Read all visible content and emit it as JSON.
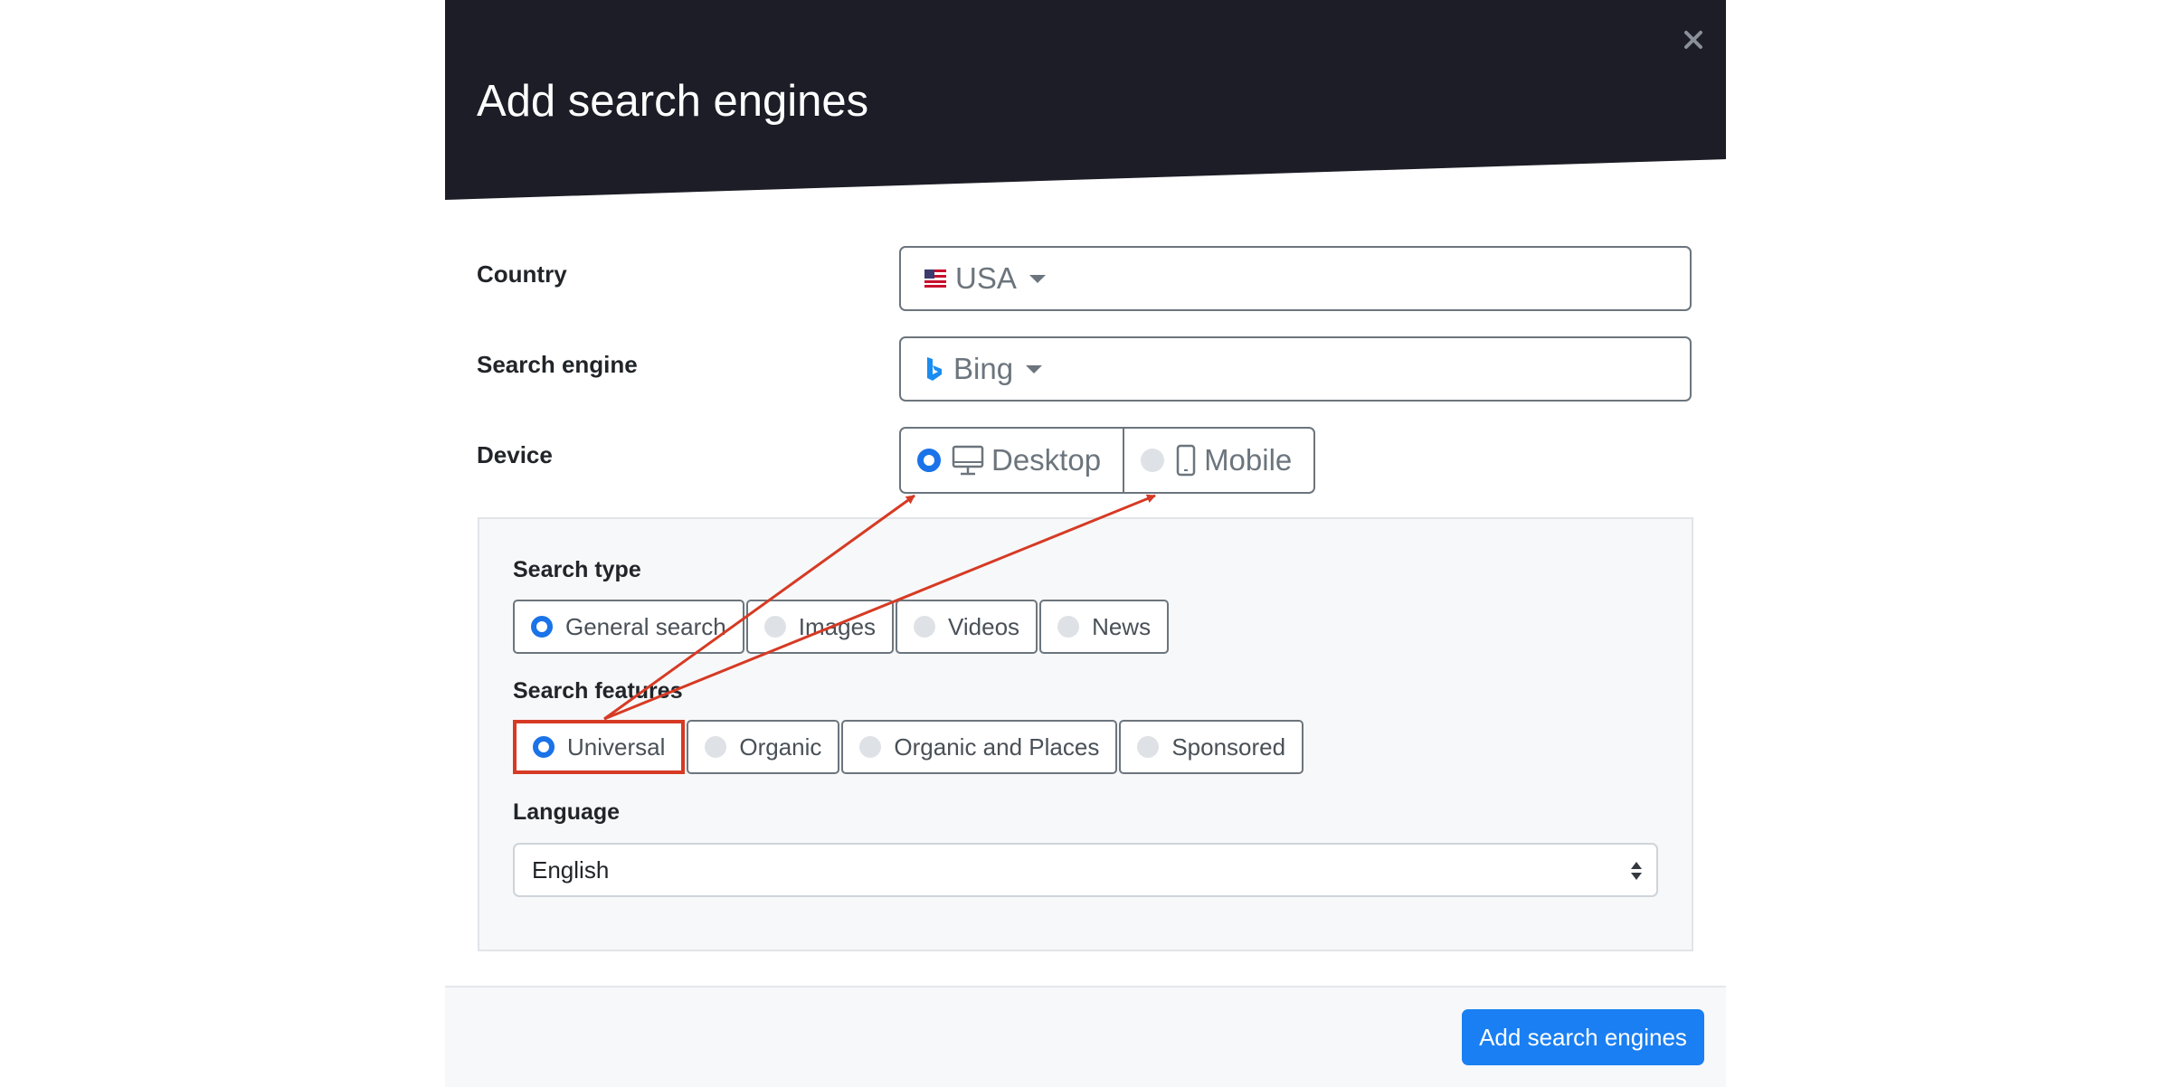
{
  "modal": {
    "title": "Add search engines",
    "close_label": "×"
  },
  "form": {
    "country": {
      "label": "Country",
      "value": "USA",
      "icon": "us-flag-icon"
    },
    "search_engine": {
      "label": "Search engine",
      "value": "Bing",
      "icon": "bing-logo-icon"
    },
    "device": {
      "label": "Device",
      "options": [
        {
          "label": "Desktop",
          "icon": "desktop-monitor-icon",
          "selected": true
        },
        {
          "label": "Mobile",
          "icon": "mobile-phone-icon",
          "selected": false
        }
      ]
    }
  },
  "panel": {
    "search_type": {
      "label": "Search type",
      "options": [
        {
          "label": "General search",
          "selected": true
        },
        {
          "label": "Images",
          "selected": false
        },
        {
          "label": "Videos",
          "selected": false
        },
        {
          "label": "News",
          "selected": false
        }
      ]
    },
    "search_features": {
      "label": "Search features",
      "options": [
        {
          "label": "Universal",
          "selected": true
        },
        {
          "label": "Organic",
          "selected": false
        },
        {
          "label": "Organic and Places",
          "selected": false
        },
        {
          "label": "Sponsored",
          "selected": false
        }
      ]
    },
    "language": {
      "label": "Language",
      "value": "English"
    }
  },
  "footer": {
    "submit_label": "Add search engines"
  },
  "colors": {
    "header_bg": "#1c1d26",
    "accent": "#1a7ff2",
    "radio_checked": "#1a73e8",
    "annotation": "#d63a24"
  }
}
